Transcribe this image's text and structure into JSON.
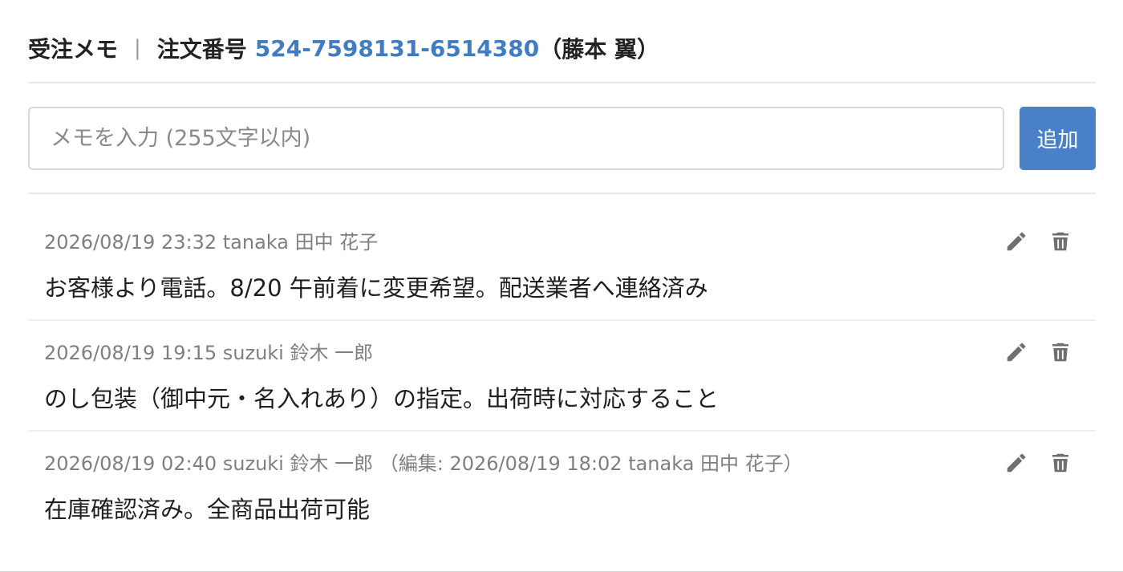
{
  "header": {
    "title": "受注メモ",
    "separator": "|",
    "order_label": "注文番号",
    "order_number": "524-7598131-6514380",
    "customer": "（藤本 翼）"
  },
  "input": {
    "placeholder": "メモを入力 (255文字以内)",
    "value": ""
  },
  "add_button": {
    "label": "追加"
  },
  "colors": {
    "accent": "#4a80c8",
    "link": "#3f7cc4",
    "meta_text": "#7f7f7f",
    "icon": "#6f6f6f"
  },
  "icons": {
    "edit": "pencil-icon",
    "delete": "trash-icon"
  },
  "memos": [
    {
      "meta": "2026/08/19 23:32 tanaka 田中 花子",
      "text": "お客様より電話。8/20 午前着に変更希望。配送業者へ連絡済み"
    },
    {
      "meta": "2026/08/19 19:15 suzuki 鈴木 一郎",
      "text": "のし包装（御中元・名入れあり）の指定。出荷時に対応すること"
    },
    {
      "meta": "2026/08/19 02:40 suzuki 鈴木 一郎 （編集: 2026/08/19 18:02 tanaka 田中 花子）",
      "text": "在庫確認済み。全商品出荷可能"
    }
  ]
}
